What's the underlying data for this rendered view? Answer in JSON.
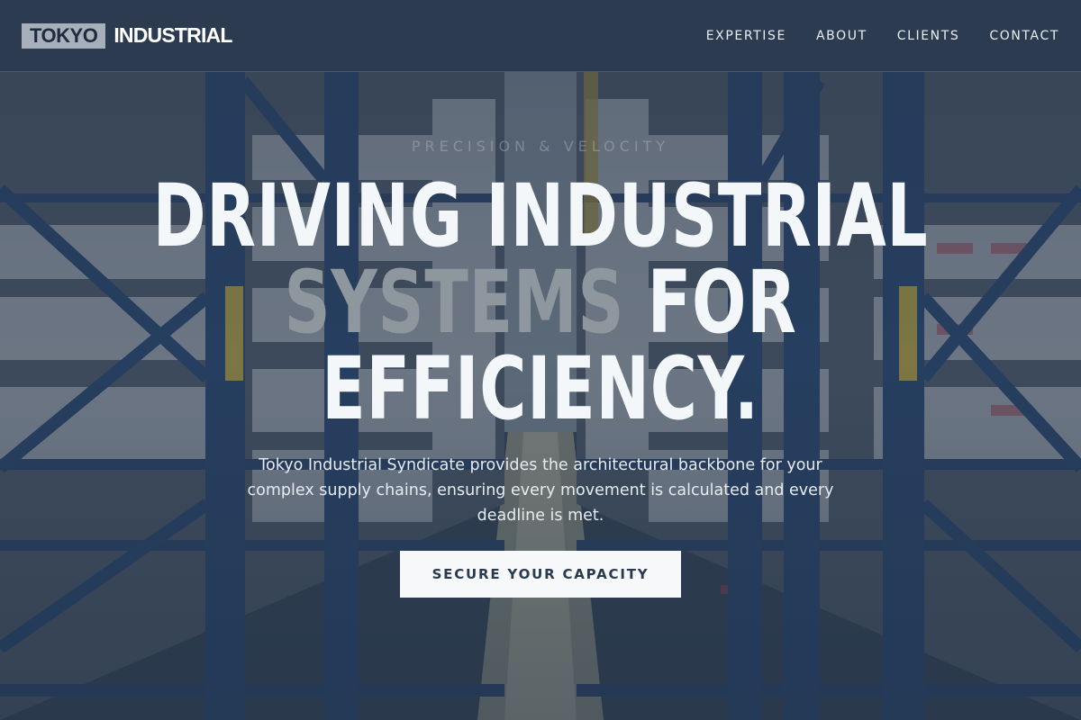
{
  "header": {
    "logo_box": "TOKYO",
    "logo_word": "INDUSTRIAL",
    "nav": [
      {
        "label": "EXPERTISE"
      },
      {
        "label": "ABOUT"
      },
      {
        "label": "CLIENTS"
      },
      {
        "label": "CONTACT"
      }
    ]
  },
  "hero": {
    "eyebrow": "PRECISION & VELOCITY",
    "headline_line1": "DRIVING INDUSTRIAL",
    "headline_line2_muted": "SYSTEMS",
    "headline_line2_rest": " FOR",
    "headline_line3": "EFFICIENCY.",
    "subtext": "Tokyo Industrial Syndicate provides the architectural backbone for your complex supply chains, ensuring every movement is calculated and every deadline is met.",
    "cta_label": "SECURE YOUR CAPACITY"
  },
  "colors": {
    "header_bg": "#2c3b50",
    "logo_box_bg": "#a7b0ba",
    "headline": "#f4f7fa",
    "headline_muted": "#8e979d",
    "cta_bg": "#f6f8fa",
    "cta_text": "#2a3a4e"
  },
  "icons": [
    "warehouse-background-image"
  ]
}
